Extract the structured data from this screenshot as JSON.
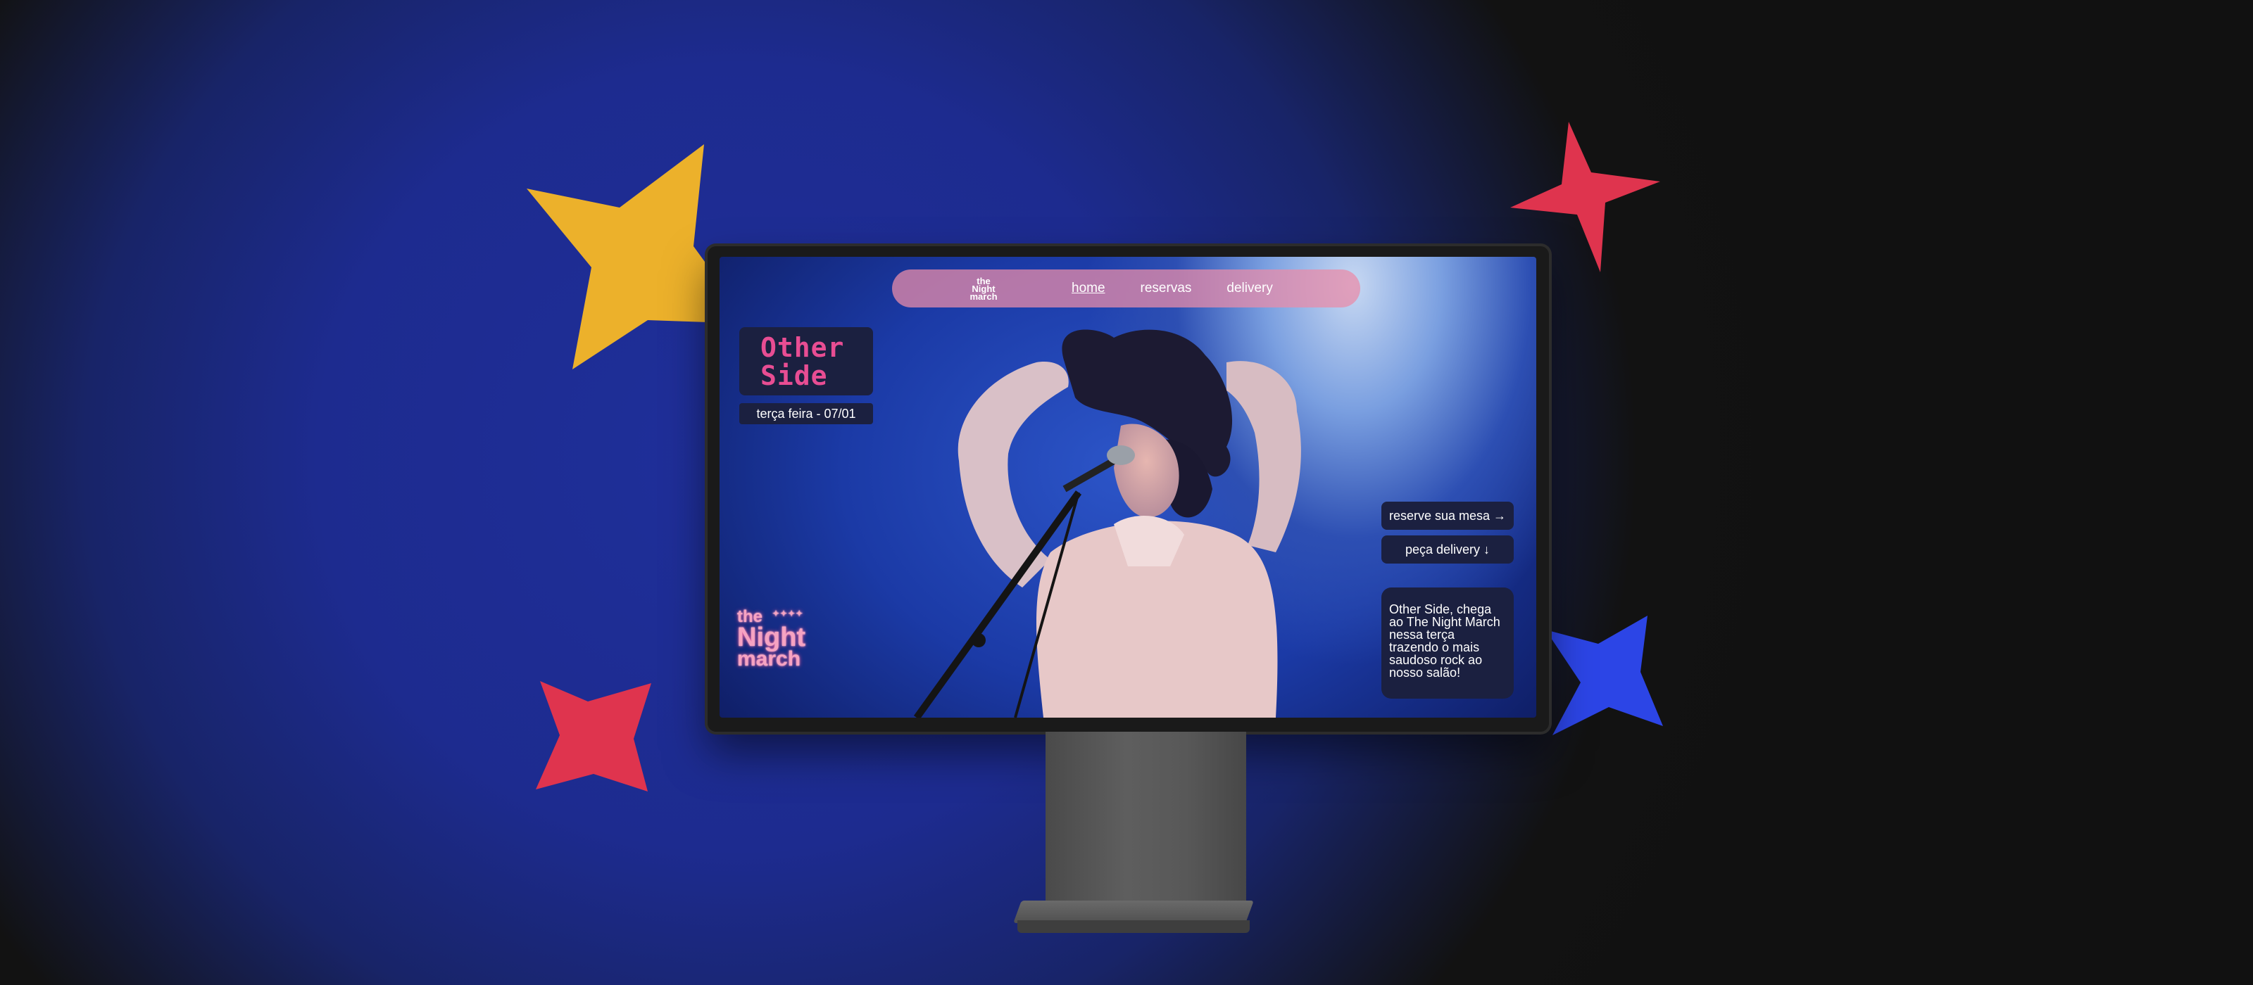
{
  "colors": {
    "yellow_star": "#ecb12b",
    "red_star": "#df344e",
    "blue_star": "#2c45e6",
    "navbar_pink": "#e88caa",
    "card_bg": "#1b2040",
    "logo_pink": "#e84d93",
    "logo_green": "#8ad04a"
  },
  "nav": {
    "logo_top": "the",
    "logo_mid": "Night",
    "logo_bottom": "march",
    "links": [
      "home",
      "reservas",
      "delivery"
    ]
  },
  "event": {
    "logo_line1": "Other",
    "logo_line2": "Side",
    "date": "terça feira - 07/01"
  },
  "brand": {
    "line1": "the",
    "line2": "Night",
    "line3": "march"
  },
  "cta": {
    "reserve": "reserve sua mesa →",
    "delivery": "peça delivery ↓"
  },
  "info": {
    "text": "Other Side, chega ao The Night March nessa terça trazendo o mais saudoso rock ao nosso salão!"
  }
}
